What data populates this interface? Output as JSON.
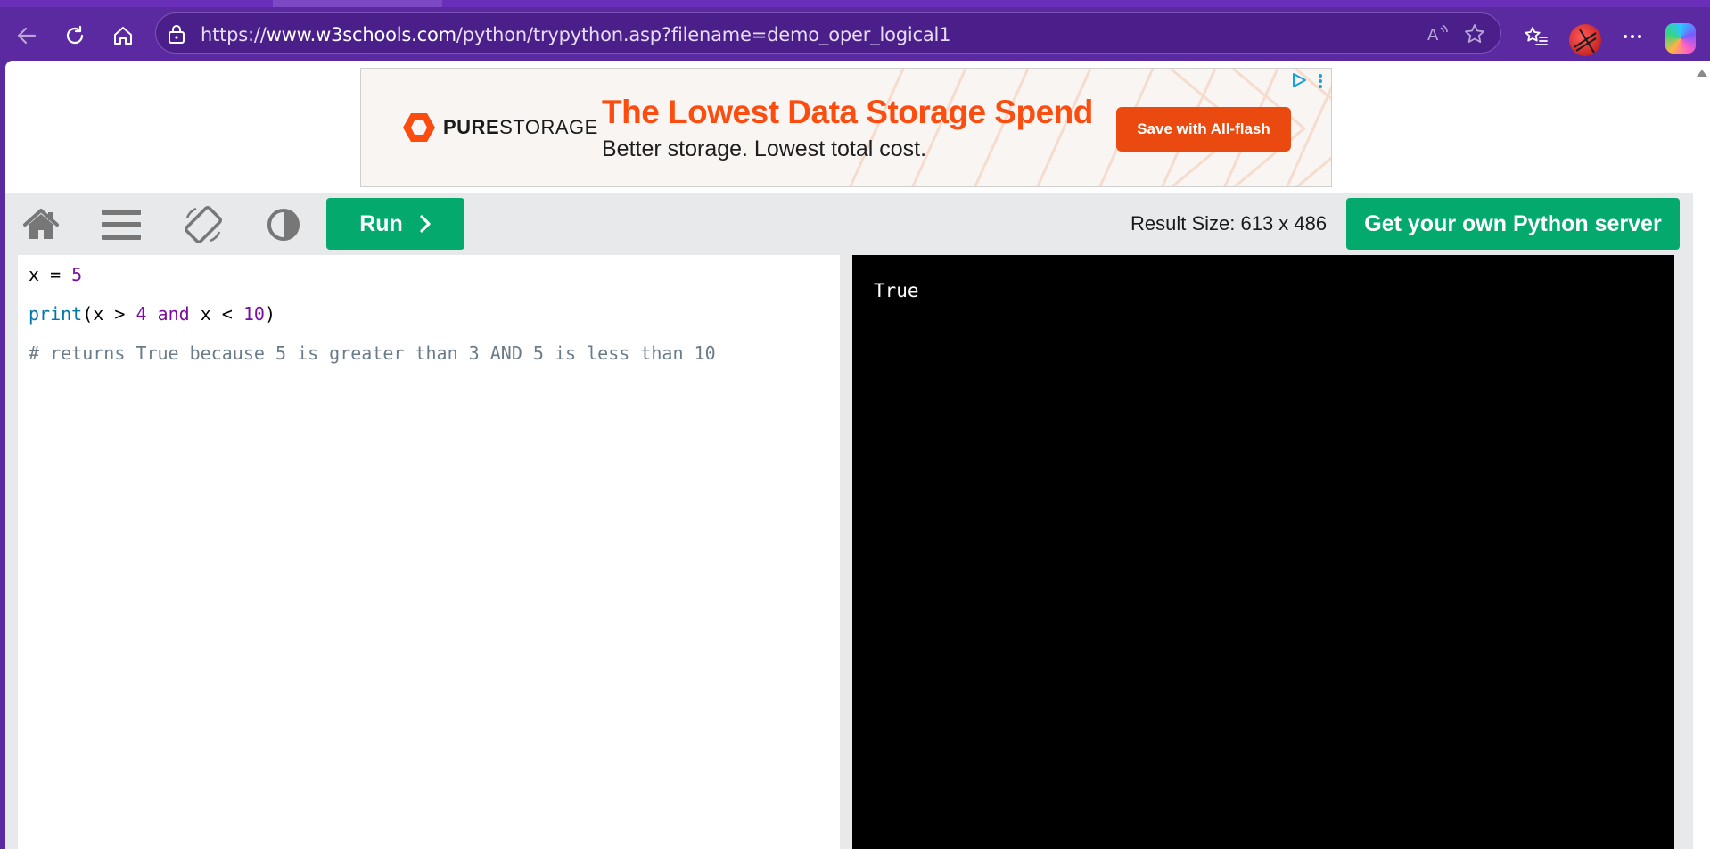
{
  "browser": {
    "url_prefix": "https://",
    "url_host": "www.w3schools.com",
    "url_path": "/python/trypython.asp?filename=demo_oper_logical1",
    "icons": [
      "back-icon",
      "refresh-icon",
      "home-icon",
      "lock-icon",
      "read-aloud-icon",
      "favorite-star-icon",
      "favorites-list-icon",
      "profile-avatar",
      "more-icon",
      "copilot-icon"
    ]
  },
  "ad": {
    "brand_bold": "PURE",
    "brand_light": "STORAGE",
    "headline": "The Lowest Data Storage Spend",
    "subline": "Better storage. Lowest total cost.",
    "cta": "Save with All-flash",
    "accent_color": "#fa4d0f"
  },
  "toolbar": {
    "run_label": "Run",
    "result_size": "Result Size: 613 x 486",
    "server_button": "Get your own Python server",
    "accent_color": "#04aa6d"
  },
  "code": {
    "line1": {
      "var": "x",
      "op": " = ",
      "num": "5"
    },
    "line2": {
      "fn": "print",
      "p1": "(x > ",
      "n1": "4",
      "kw": "and",
      "p2": " x < ",
      "n2": "10",
      "close": ")"
    },
    "line3": "# returns True because 5 is greater than 3 AND 5 is less than 10"
  },
  "output": {
    "text": "True"
  }
}
